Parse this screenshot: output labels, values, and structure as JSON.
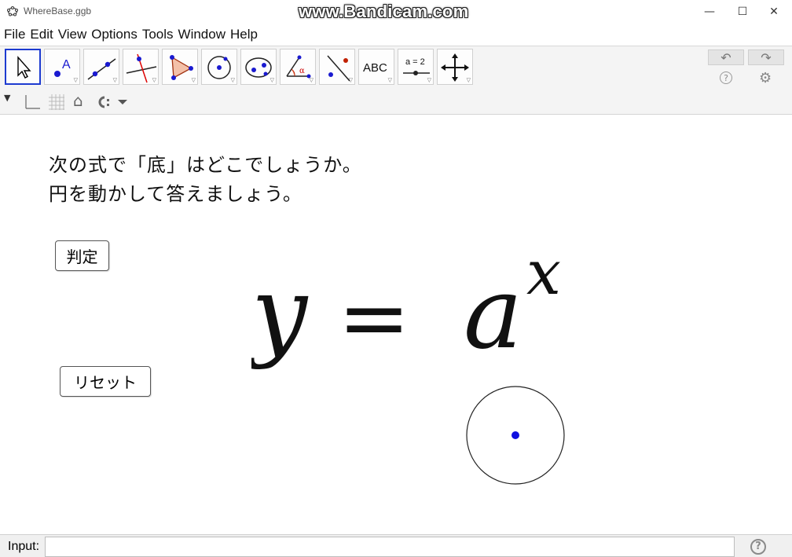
{
  "window": {
    "title": "WhereBase.ggb",
    "watermark": "www.Bandicam.com",
    "minimize": "—",
    "maximize": "☐",
    "close": "✕"
  },
  "menu": [
    "File",
    "Edit",
    "View",
    "Options",
    "Tools",
    "Window",
    "Help"
  ],
  "toolbar": {
    "tools": [
      {
        "name": "move-tool",
        "selected": true
      },
      {
        "name": "point-tool",
        "glyph": "A"
      },
      {
        "name": "line-tool"
      },
      {
        "name": "perpendicular-line-tool"
      },
      {
        "name": "polygon-tool"
      },
      {
        "name": "circle-center-point-tool"
      },
      {
        "name": "conic-tool"
      },
      {
        "name": "angle-tool",
        "glyph": "α"
      },
      {
        "name": "reflect-tool"
      },
      {
        "name": "text-tool",
        "glyph": "ABC"
      },
      {
        "name": "slider-tool",
        "glyph": "a = 2"
      },
      {
        "name": "move-graphics-view-tool"
      }
    ],
    "undo": "↶",
    "redo": "↷",
    "help": "?",
    "settings": "⚙"
  },
  "stylebar": {
    "collapse": "▼",
    "home": "⌂"
  },
  "graphics": {
    "question_line1": "次の式で「底」はどこでしょうか。",
    "question_line2": "円を動かして答えましょう。",
    "judge_button": "判定",
    "reset_button": "リセット",
    "formula": {
      "lhs": "y",
      "equals": "=",
      "base": "a",
      "exponent": "x"
    },
    "point_color": "#1010e0"
  },
  "inputbar": {
    "label": "Input:",
    "value": "",
    "help": "?"
  }
}
